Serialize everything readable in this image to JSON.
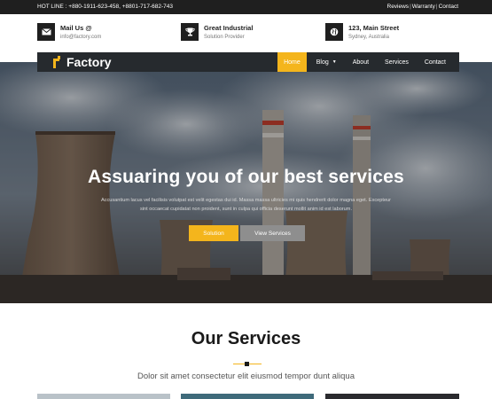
{
  "topbar": {
    "hotline": "HOT LINE : +880-1911-623-458, +8801-717-682-743",
    "links": [
      "Reviews",
      "Warranty",
      "Contact"
    ]
  },
  "info": [
    {
      "icon": "envelope-icon",
      "title": "Mail Us @",
      "sub": "info@factory.com"
    },
    {
      "icon": "trophy-icon",
      "title": "Great Industrial",
      "sub": "Solution Provider"
    },
    {
      "icon": "globe-icon",
      "title": "123, Main Street",
      "sub": "Sydney, Australia"
    }
  ],
  "nav": {
    "brand": "Factory",
    "items": [
      "Home",
      "Blog",
      "About",
      "Services",
      "Contact"
    ],
    "active": "Home"
  },
  "hero": {
    "headline": "Assuaring you of our best services",
    "lead": "Accusantium lacus vel facilisis volutpat est velit egestas dui id. Massa massa ultricies mi quis hendrerit dolor magna eget. Excepteur sint occaecat cupidatat non proident, sunt in culpa qui officia deserunt mollit anim id est laborum.",
    "btn_primary": "Solution",
    "btn_secondary": "View Services"
  },
  "services": {
    "title": "Our Services",
    "subtitle": "Dolor sit amet consectetur elit eiusmod tempor dunt aliqua"
  },
  "colors": {
    "accent": "#f4b51c",
    "dark": "#1f1f1f",
    "nav": "#262a2e"
  }
}
